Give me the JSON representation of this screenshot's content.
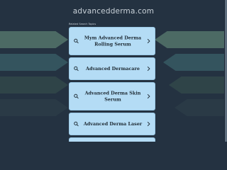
{
  "header": {
    "domain": "advancedderma.com"
  },
  "section": {
    "label": "Related Search Topics"
  },
  "links": [
    {
      "label": "Mym Advanced Derma Rolling Serum"
    },
    {
      "label": "Advanced Dermacare"
    },
    {
      "label": "Advanced Derma Skin Serum"
    },
    {
      "label": "Advanced Derma Laser"
    },
    {
      "label": ""
    }
  ],
  "icons": {
    "search": "search-icon",
    "chevron": "chevron-right-icon"
  },
  "colors": {
    "background": "#243241",
    "card": "#b4dcf5",
    "card_text": "#1e2a33",
    "title_text": "#c9d1d8"
  }
}
